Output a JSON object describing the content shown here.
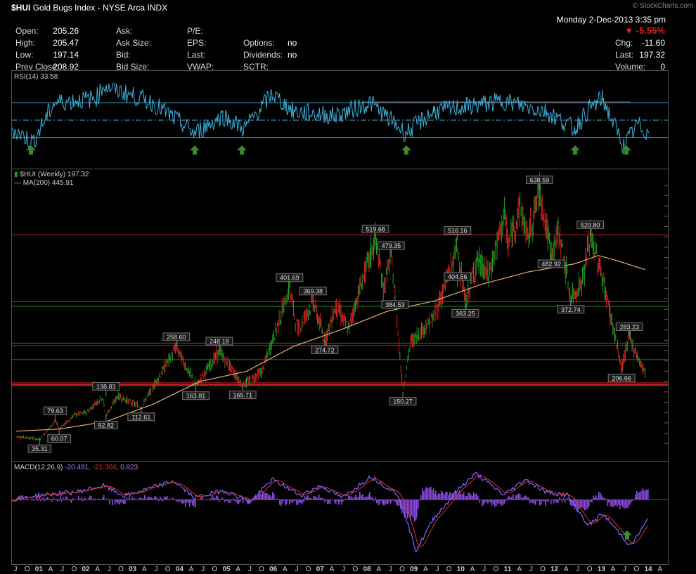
{
  "header": {
    "symbol": "$HUI",
    "name": "Gold Bugs Index - NYSE Arca",
    "type": "INDX",
    "watermark": "© StockCharts.com",
    "date": "Monday  2-Dec-2013  3:35 pm",
    "pct": "-5.55%",
    "stats": [
      {
        "label": "Open:",
        "value": "205.26"
      },
      {
        "label": "High:",
        "value": "205.47"
      },
      {
        "label": "Low:",
        "value": "197.14"
      },
      {
        "label": "Prev Close:",
        "value": "208.92"
      }
    ],
    "stats2": [
      {
        "label": "Ask:",
        "value": ""
      },
      {
        "label": "Ask Size:",
        "value": ""
      },
      {
        "label": "Bid:",
        "value": ""
      },
      {
        "label": "Bid Size:",
        "value": ""
      }
    ],
    "stats3": [
      {
        "label": "P/E:",
        "value": ""
      },
      {
        "label": "EPS:",
        "value": ""
      },
      {
        "label": "Last:",
        "value": ""
      },
      {
        "label": "VWAP:",
        "value": ""
      }
    ],
    "stats4": [
      {
        "label": "",
        "value": ""
      },
      {
        "label": "Options:",
        "value": "no"
      },
      {
        "label": "Dividends:",
        "value": "no"
      },
      {
        "label": "SCTR:",
        "value": ""
      }
    ],
    "right": [
      {
        "label": "Chg:",
        "value": "-11.60"
      },
      {
        "label": "Last:",
        "value": "197.32"
      },
      {
        "label": "Volume:",
        "value": "0"
      }
    ]
  },
  "colors": {
    "price_up": "#20a020",
    "price_down": "#e02020",
    "ma": "#e8b070",
    "rsi": "#3ab0d8",
    "macd": "#8a4ae0",
    "signal": "#e03030",
    "hline_red": "#c02020",
    "hline_green": "#208020"
  },
  "chart_data": [
    {
      "type": "line",
      "title": "RSI(14) 33.58",
      "last_value": "33.58",
      "ylim": [
        0,
        100
      ],
      "y_ticks": [
        "90",
        "70",
        "50",
        "30",
        "10"
      ],
      "levels": [
        70,
        50,
        30
      ]
    },
    {
      "type": "line",
      "title": "$HUI (Weekly) 197.32",
      "ma_label": "MA(200) 445.91",
      "last_value": "197.32",
      "ma_value": "445.91",
      "ylim": [
        0,
        675
      ],
      "y_ticks": [
        "650",
        "625",
        "600",
        "575",
        "550",
        "525",
        "500",
        "475",
        "450",
        "425",
        "400",
        "375",
        "350",
        "325",
        "300",
        "275",
        "250",
        "225",
        "200",
        "175",
        "150",
        "125",
        "100",
        "75",
        "50",
        "25"
      ],
      "annotations": [
        {
          "x": "2001-01",
          "y": 35.31,
          "label": "35.31"
        },
        {
          "x": "2001-06",
          "y": 60.07,
          "label": "60.07"
        },
        {
          "x": "2001-05",
          "y": 79.63,
          "label": "79.63"
        },
        {
          "x": "2002-06",
          "y": 92.82,
          "label": "92.82"
        },
        {
          "x": "2002-06",
          "y": 138.83,
          "label": "138.83"
        },
        {
          "x": "2003-03",
          "y": 112.61,
          "label": "112.61"
        },
        {
          "x": "2003-12",
          "y": 258.6,
          "label": "258.60"
        },
        {
          "x": "2004-05",
          "y": 163.81,
          "label": "163.81"
        },
        {
          "x": "2004-11",
          "y": 248.18,
          "label": "248.18"
        },
        {
          "x": "2005-05",
          "y": 165.71,
          "label": "165.71"
        },
        {
          "x": "2006-05",
          "y": 401.69,
          "label": "401.69"
        },
        {
          "x": "2006-11",
          "y": 369.38,
          "label": "369.38"
        },
        {
          "x": "2007-02",
          "y": 274.72,
          "label": "274.72"
        },
        {
          "x": "2008-03",
          "y": 519.68,
          "label": "519.68"
        },
        {
          "x": "2008-08",
          "y": 384.53,
          "label": "384.53"
        },
        {
          "x": "2008-07",
          "y": 479.35,
          "label": "479.35"
        },
        {
          "x": "2008-10",
          "y": 150.27,
          "label": "150.27"
        },
        {
          "x": "2009-12",
          "y": 404.56,
          "label": "404.56"
        },
        {
          "x": "2009-12",
          "y": 516.16,
          "label": "516.16"
        },
        {
          "x": "2010-02",
          "y": 363.25,
          "label": "363.25"
        },
        {
          "x": "2011-09",
          "y": 638.59,
          "label": "638.59"
        },
        {
          "x": "2011-12",
          "y": 482.92,
          "label": "482.92"
        },
        {
          "x": "2012-05",
          "y": 372.74,
          "label": "372.74"
        },
        {
          "x": "2012-10",
          "y": 529.8,
          "label": "529.80"
        },
        {
          "x": "2013-08",
          "y": 283.23,
          "label": "283.23"
        },
        {
          "x": "2013-06",
          "y": 206.66,
          "label": "206.66"
        }
      ],
      "x_labels": [
        "J",
        "O",
        "01",
        "A",
        "J",
        "O",
        "02",
        "A",
        "J",
        "O",
        "03",
        "A",
        "J",
        "O",
        "04",
        "A",
        "J",
        "O",
        "05",
        "A",
        "J",
        "O",
        "06",
        "A",
        "J",
        "O",
        "07",
        "A",
        "J",
        "O",
        "08",
        "A",
        "J",
        "O",
        "09",
        "A",
        "J",
        "O",
        "10",
        "A",
        "J",
        "O",
        "11",
        "A",
        "J",
        "O",
        "12",
        "A",
        "J",
        "O",
        "13",
        "A",
        "J",
        "O",
        "14",
        "A"
      ]
    },
    {
      "type": "line",
      "title": "MACD(12,26,9)",
      "values_label": [
        "-20.481",
        ", -21.304",
        ", 0.823"
      ],
      "last_values": [
        "0.823",
        "-20.481"
      ],
      "ylim": [
        -65,
        35
      ],
      "y_ticks": [
        "20",
        "-20",
        "-40",
        "-60"
      ]
    }
  ]
}
